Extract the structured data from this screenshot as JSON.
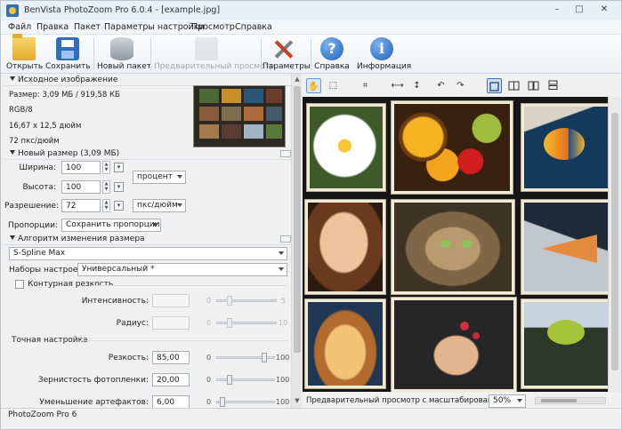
{
  "window": {
    "title": "BenVista PhotoZoom Pro 6.0.4 - [example.jpg]",
    "controls": {
      "minimize": "–",
      "maximize": "□",
      "close": "✕"
    }
  },
  "menu": [
    "Файл",
    "Правка",
    "Пакет",
    "Параметры настройки",
    "Просмотр",
    "Справка"
  ],
  "toolbar": {
    "open": "Открыть",
    "save": "Сохранить",
    "batch": "Новый пакет",
    "preview": "Предварительный просмотр",
    "params": "Параметры",
    "help": "Справка",
    "info": "Информация",
    "help_glyph": "?",
    "info_glyph": "i"
  },
  "source": {
    "header": "Исходное изображение",
    "size": "Размер: 3,09 МБ / 919,58 КБ",
    "mode": "RGB/8",
    "dims": "16,67 x 12,5 дюйм",
    "res": "72 пкс/дюйм"
  },
  "newsize": {
    "header": "Новый размер (3,09 МБ)",
    "width_label": "Ширина:",
    "width_value": "100",
    "height_label": "Высота:",
    "height_value": "100",
    "resolution_label": "Разрешение:",
    "resolution_value": "72",
    "unit_percent": "процент",
    "unit_ppi": "пкс/дюйм",
    "proportions_label": "Пропорции:",
    "proportions_value": "Сохранить пропорции"
  },
  "algorithm": {
    "header": "Алгоритм изменения размера",
    "method": "S-Spline Max",
    "presets_label": "Наборы настроек:",
    "presets_value": "Универсальный *"
  },
  "unsharp": {
    "label": "Контурная резкость",
    "intensity_label": "Интенсивность:",
    "intensity_min": "0",
    "intensity_max": "5",
    "radius_label": "Радиус:",
    "radius_min": "0",
    "radius_max": "10"
  },
  "fine": {
    "header": "Точная настройка",
    "sharpness_label": "Резкость:",
    "sharpness_value": "85,00",
    "film_grain_label": "Зернистость фотопленки:",
    "film_grain_value": "20,00",
    "artifact_label": "Уменьшение артефактов:",
    "artifact_value": "6,00",
    "min": "0",
    "max": "100"
  },
  "slider_levels": {
    "sharpness": 0.85,
    "film_grain": 0.2,
    "artifact": 0.06
  },
  "view_tools": {
    "hand": "✋",
    "select": "⬚",
    "crop": "⌗",
    "fit_width": "⟷",
    "fit_height": "↕",
    "rotate_left": "↶",
    "rotate_right": "↷"
  },
  "preview": {
    "scaled_label": "Предварительный просмотр с масштабированием:",
    "zoom_value": "50%"
  },
  "status": "PhotoZoom Pro 6",
  "colors": {
    "accent_blue": "#1d5fb8",
    "frame_cream": "#f1ead8",
    "preview_bg": "#161616"
  }
}
